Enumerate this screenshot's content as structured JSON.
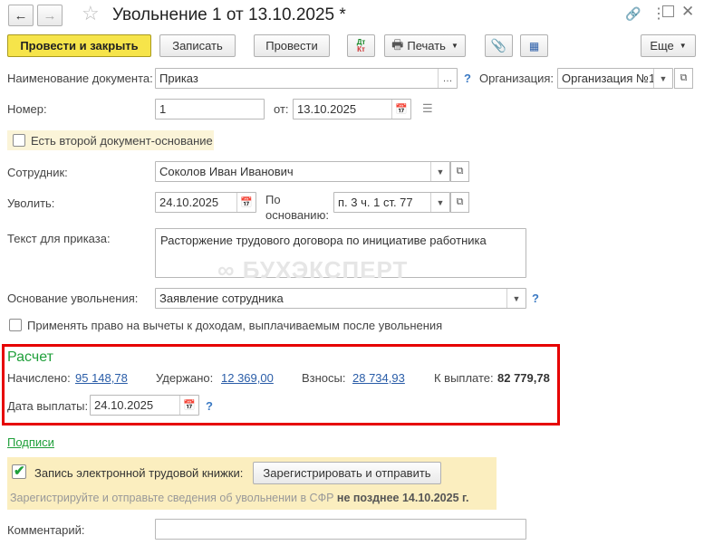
{
  "window": {
    "title": "Увольнение 1 от 13.10.2025 *"
  },
  "toolbar": {
    "post_close": "Провести и закрыть",
    "save": "Записать",
    "post": "Провести",
    "dtkt": "Дт Кт",
    "print": "Печать",
    "more": "Еще"
  },
  "form": {
    "doc_name_label": "Наименование документа:",
    "doc_name_value": "Приказ",
    "org_label": "Организация:",
    "org_value": "Организация №1",
    "number_label": "Номер:",
    "number_value": "1",
    "date_from_label": "от:",
    "date_value": "13.10.2025",
    "second_basis_label": "Есть второй документ-основание",
    "employee_label": "Сотрудник:",
    "employee_value": "Соколов Иван Иванович",
    "dismiss_label": "Уволить:",
    "dismiss_date": "24.10.2025",
    "basis_label_1": "По",
    "basis_label_2": "основанию:",
    "basis_value": "п. 3 ч. 1 ст. 77",
    "order_text_label": "Текст для приказа:",
    "order_text_value": "Расторжение трудового договора по инициативе работника",
    "reason_label": "Основание увольнения:",
    "reason_value": "Заявление сотрудника",
    "deductions_label": "Применять право на вычеты к доходам, выплачиваемым после увольнения",
    "watermark": "БУХЭКСПЕРТ"
  },
  "calc": {
    "title": "Расчет",
    "accrued_label": "Начислено:",
    "accrued_value": "95 148,78",
    "withheld_label": "Удержано:",
    "withheld_value": "12 369,00",
    "contrib_label": "Взносы:",
    "contrib_value": "28 734,93",
    "payout_label": "К выплате:",
    "payout_value": "82 779,78",
    "paydate_label": "Дата выплаты:",
    "paydate_value": "24.10.2025"
  },
  "signatures": "Подписи",
  "etk": {
    "label": "Запись электронной трудовой книжки:",
    "button": "Зарегистрировать и отправить",
    "note_prefix": "Зарегистрируйте и отправьте сведения об увольнении в СФР ",
    "note_bold": "не позднее 14.10.2025 г."
  },
  "comment_label": "Комментарий:",
  "colors": {
    "accent_yellow": "#f6e44a",
    "highlight_red": "#e60000",
    "section_green": "#1f9f3a",
    "etk_bg": "#fbeebf"
  }
}
